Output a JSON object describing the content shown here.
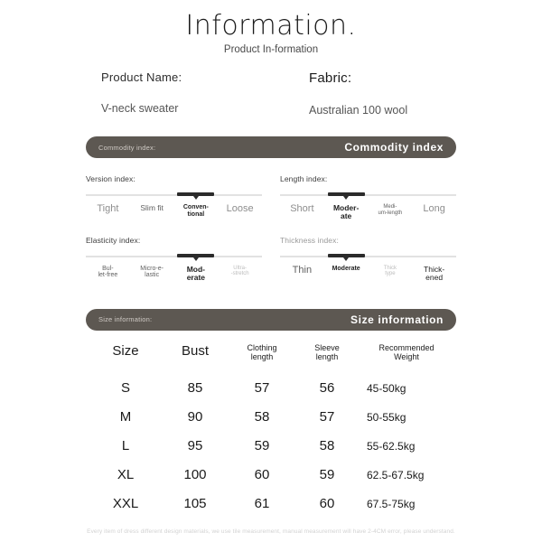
{
  "header": {
    "title": "Information.",
    "subtitle": "Product In-formation"
  },
  "product": {
    "name_label": "Product Name:",
    "name_value": "V-neck sweater",
    "fabric_label": "Fabric:",
    "fabric_value": "Australian 100 wool"
  },
  "commodity_bar": {
    "small_label": "Commodity index:",
    "big_label": "Commodity index"
  },
  "size_bar": {
    "small_label": "Size information:",
    "big_label": "Size information"
  },
  "indexes": [
    {
      "title": "Version index:",
      "selected": 2,
      "options": [
        {
          "label": "Tight",
          "size": "sz-l",
          "tone": "tone-gray"
        },
        {
          "label": "Slim fit",
          "size": "sz-m",
          "tone": "tone-mid"
        },
        {
          "label": "Conven-\ntional",
          "size": "sz-s",
          "tone": "tone-dark"
        },
        {
          "label": "Loose",
          "size": "sz-l",
          "tone": "tone-gray"
        }
      ]
    },
    {
      "title": "Length index:",
      "selected": 1,
      "options": [
        {
          "label": "Short",
          "size": "sz-l",
          "tone": "tone-gray"
        },
        {
          "label": "Moder-\nate",
          "size": "sz-m",
          "tone": "tone-dark"
        },
        {
          "label": "Medi-\num-length",
          "size": "sz-xs",
          "tone": "tone-mid"
        },
        {
          "label": "Long",
          "size": "sz-l",
          "tone": "tone-gray"
        }
      ]
    },
    {
      "title": "Elasticity index:",
      "selected": 2,
      "options": [
        {
          "label": "Bul-\nlet-free",
          "size": "sz-s",
          "tone": "tone-mid"
        },
        {
          "label": "Micro-e-\nlastic",
          "size": "sz-s",
          "tone": "tone-mid"
        },
        {
          "label": "Mod-\nerate",
          "size": "sz-m",
          "tone": "tone-dark"
        },
        {
          "label": "Ultra-\n-stretch",
          "size": "sz-xs",
          "tone": "tone-light"
        }
      ]
    },
    {
      "title": "Thickness index:",
      "title_light": true,
      "selected": 1,
      "options": [
        {
          "label": "Thin",
          "size": "sz-l",
          "tone": "tone-mid"
        },
        {
          "label": "Moderate",
          "size": "sz-s",
          "tone": "tone-dark"
        },
        {
          "label": "Thick\ntype",
          "size": "sz-xs",
          "tone": "tone-light"
        },
        {
          "label": "Thick-\nened",
          "size": "sz-m",
          "tone": "tone-dark"
        }
      ]
    }
  ],
  "size_table": {
    "headers": [
      {
        "text": "Size",
        "style": "big"
      },
      {
        "text": "Bust",
        "style": "big"
      },
      {
        "text": "Clothing\nlength",
        "style": "small"
      },
      {
        "text": "Sleeve\nlength",
        "style": "small"
      },
      {
        "text": "Recommended\nWeight",
        "style": "small"
      }
    ],
    "rows": [
      {
        "size": "S",
        "bust": "85",
        "clothing_length": "57",
        "sleeve_length": "56",
        "weight": "45-50kg"
      },
      {
        "size": "M",
        "bust": "90",
        "clothing_length": "58",
        "sleeve_length": "57",
        "weight": "50-55kg"
      },
      {
        "size": "L",
        "bust": "95",
        "clothing_length": "59",
        "sleeve_length": "58",
        "weight": "55-62.5kg"
      },
      {
        "size": "XL",
        "bust": "100",
        "clothing_length": "60",
        "sleeve_length": "59",
        "weight": "62.5-67.5kg"
      },
      {
        "size": "XXL",
        "bust": "105",
        "clothing_length": "61",
        "sleeve_length": "60",
        "weight": "67.5-75kg"
      }
    ]
  },
  "footer": {
    "disclaimer": "Every item of dress different design materials, we use tile measurement, manual measurement will have 2-4CM error, please understand."
  },
  "colors": {
    "bar_background": "#5d5852",
    "scale_active": "#2b2b2b",
    "scale_track": "#e2e2e2",
    "page_background": "#ffffff"
  }
}
